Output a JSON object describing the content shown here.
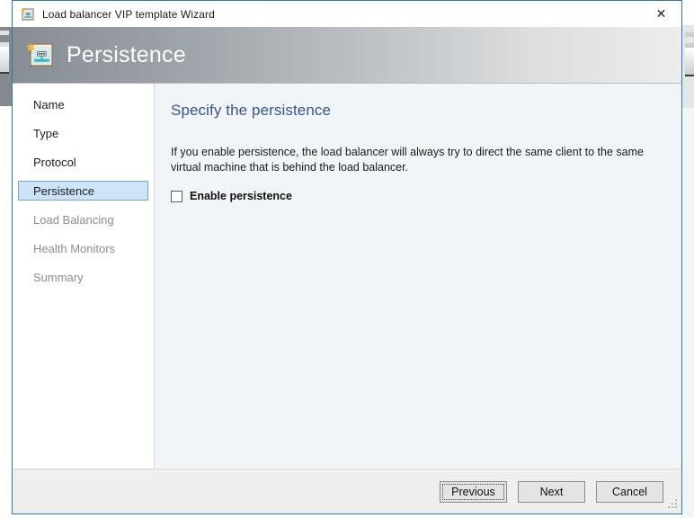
{
  "window": {
    "title": "Load balancer VIP template Wizard",
    "title_icon": "wizard-window-icon",
    "close_label": "✕",
    "border_color": "#2e7cab"
  },
  "banner": {
    "title": "Persistence",
    "icon": "wizard-window-icon",
    "gradient_from": "#878d94",
    "gradient_to": "#eceded",
    "title_color": "#ffffff"
  },
  "sidebar": {
    "items": [
      {
        "label": "Name",
        "state": "visited"
      },
      {
        "label": "Type",
        "state": "visited"
      },
      {
        "label": "Protocol",
        "state": "visited"
      },
      {
        "label": "Persistence",
        "state": "selected"
      },
      {
        "label": "Load Balancing",
        "state": "disabled"
      },
      {
        "label": "Health Monitors",
        "state": "disabled"
      },
      {
        "label": "Summary",
        "state": "disabled"
      }
    ],
    "selected_bg": "#cde3f7",
    "selected_border": "#7aa5c9"
  },
  "content": {
    "heading": "Specify the persistence",
    "heading_color": "#3a5391",
    "paragraph": "If you enable persistence, the load balancer will always try to direct the same client to the same virtual machine that is behind the load balancer.",
    "checkbox": {
      "label": "Enable persistence",
      "checked": false
    },
    "background": "#f1f5f8"
  },
  "footer": {
    "buttons": [
      {
        "label": "Previous",
        "focused": true
      },
      {
        "label": "Next",
        "focused": false
      },
      {
        "label": "Cancel",
        "focused": false
      }
    ],
    "resize_grip": "resize-grip-icon",
    "background": "#efefef"
  }
}
